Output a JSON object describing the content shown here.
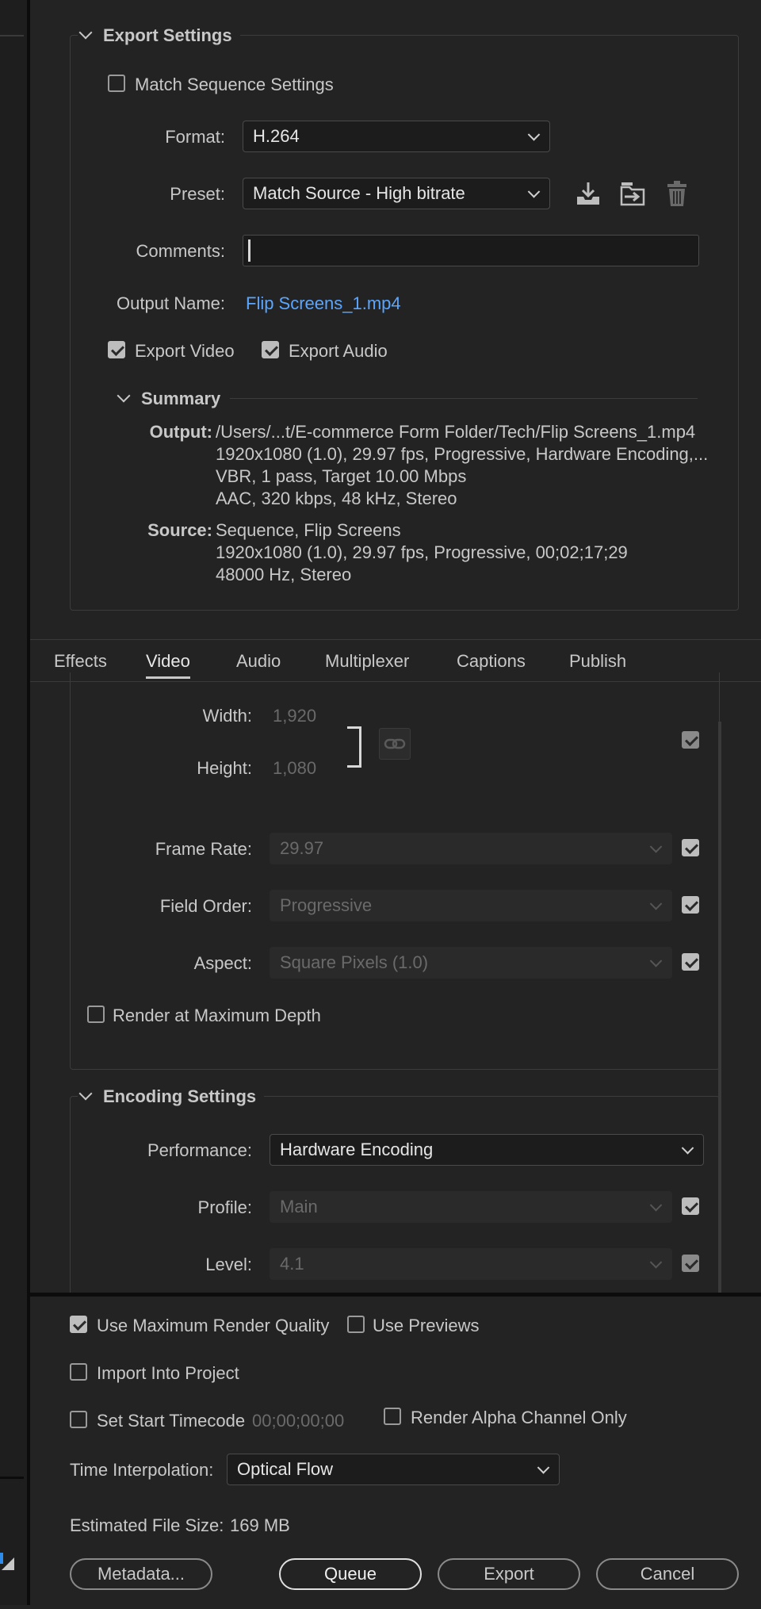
{
  "export_settings": {
    "title": "Export Settings",
    "match_sequence": {
      "label": "Match Sequence Settings",
      "checked": false
    },
    "format": {
      "label": "Format:",
      "value": "H.264"
    },
    "preset": {
      "label": "Preset:",
      "value": "Match Source - High bitrate"
    },
    "preset_icons": [
      "import-preset-icon",
      "manage-presets-icon",
      "delete-preset-icon"
    ],
    "comments": {
      "label": "Comments:",
      "value": ""
    },
    "output_name": {
      "label": "Output Name:",
      "value": "Flip Screens_1.mp4"
    },
    "export_video": {
      "label": "Export Video",
      "checked": true
    },
    "export_audio": {
      "label": "Export Audio",
      "checked": true
    },
    "summary": {
      "title": "Summary",
      "output_label": "Output:",
      "output_lines": [
        "/Users/...t/E-commerce Form Folder/Tech/Flip Screens_1.mp4",
        "1920x1080 (1.0), 29.97 fps, Progressive, Hardware Encoding,...",
        "VBR, 1 pass, Target 10.00 Mbps",
        "AAC, 320 kbps, 48 kHz, Stereo"
      ],
      "source_label": "Source:",
      "source_lines": [
        "Sequence, Flip Screens",
        "1920x1080 (1.0), 29.97 fps, Progressive, 00;02;17;29",
        "48000 Hz, Stereo"
      ]
    }
  },
  "tabs": [
    {
      "label": "Effects",
      "active": false
    },
    {
      "label": "Video",
      "active": true
    },
    {
      "label": "Audio",
      "active": false
    },
    {
      "label": "Multiplexer",
      "active": false
    },
    {
      "label": "Captions",
      "active": false
    },
    {
      "label": "Publish",
      "active": false
    }
  ],
  "video": {
    "width": {
      "label": "Width:",
      "value": "1,920"
    },
    "height": {
      "label": "Height:",
      "value": "1,080"
    },
    "frame_rate": {
      "label": "Frame Rate:",
      "value": "29.97"
    },
    "field_order": {
      "label": "Field Order:",
      "value": "Progressive"
    },
    "aspect": {
      "label": "Aspect:",
      "value": "Square Pixels (1.0)"
    },
    "render_max_depth": {
      "label": "Render at Maximum Depth",
      "checked": false
    }
  },
  "encoding": {
    "title": "Encoding Settings",
    "performance": {
      "label": "Performance:",
      "value": "Hardware Encoding"
    },
    "profile": {
      "label": "Profile:",
      "value": "Main"
    },
    "level": {
      "label": "Level:",
      "value": "4.1"
    }
  },
  "bottom": {
    "use_max_render_quality": {
      "label": "Use Maximum Render Quality",
      "checked": true
    },
    "use_previews": {
      "label": "Use Previews",
      "checked": false
    },
    "import_into_project": {
      "label": "Import Into Project",
      "checked": false
    },
    "set_start_timecode": {
      "label": "Set Start Timecode",
      "checked": false,
      "value": "00;00;00;00"
    },
    "render_alpha_only": {
      "label": "Render Alpha Channel Only",
      "checked": false
    },
    "time_interpolation": {
      "label": "Time Interpolation:",
      "value": "Optical Flow"
    },
    "estimated_size": {
      "label": "Estimated File Size:",
      "value": "169 MB"
    },
    "buttons": {
      "metadata": "Metadata...",
      "queue": "Queue",
      "export": "Export",
      "cancel": "Cancel"
    }
  },
  "colors": {
    "background": "#232323",
    "link": "#5aa6ff",
    "field": "#1c1c1c"
  }
}
